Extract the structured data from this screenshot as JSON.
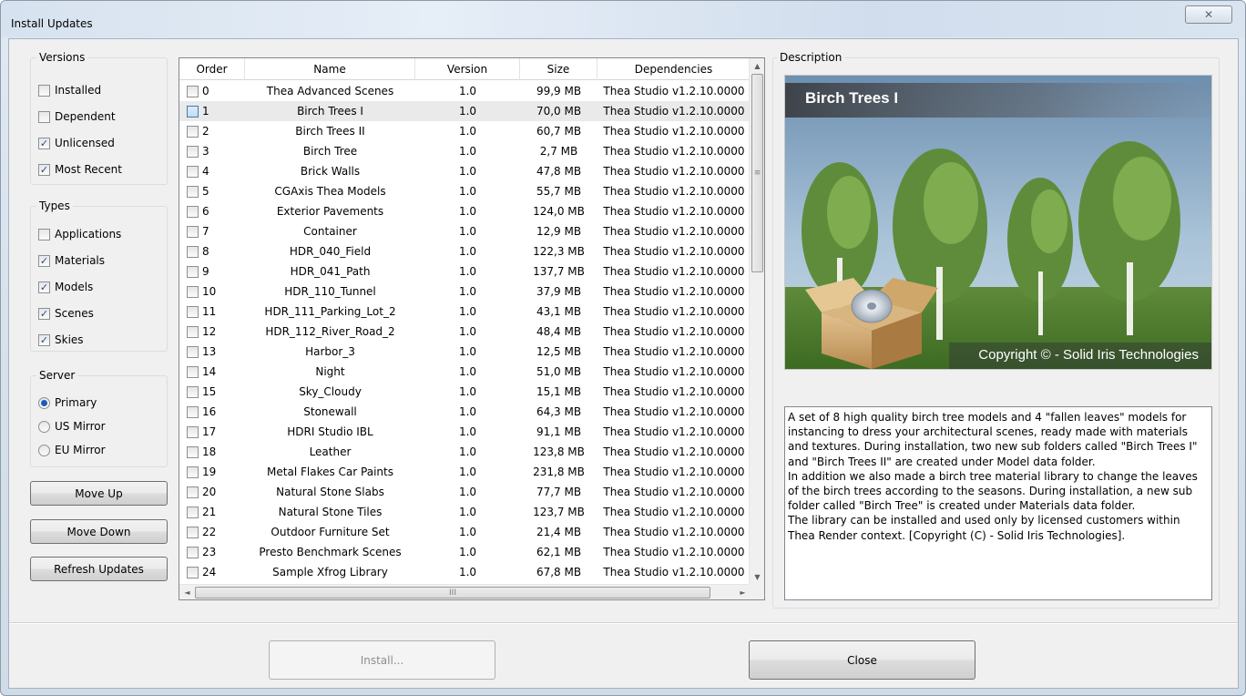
{
  "window": {
    "title": "Install Updates",
    "close_glyph": "✕"
  },
  "versions": {
    "title": "Versions",
    "items": [
      {
        "label": "Installed",
        "checked": false
      },
      {
        "label": "Dependent",
        "checked": false
      },
      {
        "label": "Unlicensed",
        "checked": true
      },
      {
        "label": "Most Recent",
        "checked": true
      }
    ]
  },
  "types": {
    "title": "Types",
    "items": [
      {
        "label": "Applications",
        "checked": false
      },
      {
        "label": "Materials",
        "checked": true
      },
      {
        "label": "Models",
        "checked": true
      },
      {
        "label": "Scenes",
        "checked": true
      },
      {
        "label": "Skies",
        "checked": true
      }
    ]
  },
  "server": {
    "title": "Server",
    "items": [
      {
        "label": "Primary",
        "selected": true
      },
      {
        "label": "US Mirror",
        "selected": false
      },
      {
        "label": "EU Mirror",
        "selected": false
      }
    ]
  },
  "buttons": {
    "move_up": "Move Up",
    "move_down": "Move Down",
    "refresh": "Refresh Updates",
    "install": "Install...",
    "close": "Close"
  },
  "list": {
    "columns": [
      "Order",
      "Name",
      "Version",
      "Size",
      "Dependencies"
    ],
    "selected_index": 1,
    "rows": [
      {
        "order": "0",
        "name": "Thea Advanced Scenes",
        "version": "1.0",
        "size": "99,9 MB",
        "deps": "Thea Studio v1.2.10.0000"
      },
      {
        "order": "1",
        "name": "Birch Trees I",
        "version": "1.0",
        "size": "70,0 MB",
        "deps": "Thea Studio v1.2.10.0000"
      },
      {
        "order": "2",
        "name": "Birch Trees II",
        "version": "1.0",
        "size": "60,7 MB",
        "deps": "Thea Studio v1.2.10.0000"
      },
      {
        "order": "3",
        "name": "Birch Tree",
        "version": "1.0",
        "size": "2,7 MB",
        "deps": "Thea Studio v1.2.10.0000"
      },
      {
        "order": "4",
        "name": "Brick Walls",
        "version": "1.0",
        "size": "47,8 MB",
        "deps": "Thea Studio v1.2.10.0000"
      },
      {
        "order": "5",
        "name": "CGAxis Thea Models",
        "version": "1.0",
        "size": "55,7 MB",
        "deps": "Thea Studio v1.2.10.0000"
      },
      {
        "order": "6",
        "name": "Exterior Pavements",
        "version": "1.0",
        "size": "124,0 MB",
        "deps": "Thea Studio v1.2.10.0000"
      },
      {
        "order": "7",
        "name": "Container",
        "version": "1.0",
        "size": "12,9 MB",
        "deps": "Thea Studio v1.2.10.0000"
      },
      {
        "order": "8",
        "name": "HDR_040_Field",
        "version": "1.0",
        "size": "122,3 MB",
        "deps": "Thea Studio v1.2.10.0000"
      },
      {
        "order": "9",
        "name": "HDR_041_Path",
        "version": "1.0",
        "size": "137,7 MB",
        "deps": "Thea Studio v1.2.10.0000"
      },
      {
        "order": "10",
        "name": "HDR_110_Tunnel",
        "version": "1.0",
        "size": "37,9 MB",
        "deps": "Thea Studio v1.2.10.0000"
      },
      {
        "order": "11",
        "name": "HDR_111_Parking_Lot_2",
        "version": "1.0",
        "size": "43,1 MB",
        "deps": "Thea Studio v1.2.10.0000"
      },
      {
        "order": "12",
        "name": "HDR_112_River_Road_2",
        "version": "1.0",
        "size": "48,4 MB",
        "deps": "Thea Studio v1.2.10.0000"
      },
      {
        "order": "13",
        "name": "Harbor_3",
        "version": "1.0",
        "size": "12,5 MB",
        "deps": "Thea Studio v1.2.10.0000"
      },
      {
        "order": "14",
        "name": "Night",
        "version": "1.0",
        "size": "51,0 MB",
        "deps": "Thea Studio v1.2.10.0000"
      },
      {
        "order": "15",
        "name": "Sky_Cloudy",
        "version": "1.0",
        "size": "15,1 MB",
        "deps": "Thea Studio v1.2.10.0000"
      },
      {
        "order": "16",
        "name": "Stonewall",
        "version": "1.0",
        "size": "64,3 MB",
        "deps": "Thea Studio v1.2.10.0000"
      },
      {
        "order": "17",
        "name": "HDRI Studio IBL",
        "version": "1.0",
        "size": "91,1 MB",
        "deps": "Thea Studio v1.2.10.0000"
      },
      {
        "order": "18",
        "name": "Leather",
        "version": "1.0",
        "size": "123,8 MB",
        "deps": "Thea Studio v1.2.10.0000"
      },
      {
        "order": "19",
        "name": "Metal Flakes Car Paints",
        "version": "1.0",
        "size": "231,8 MB",
        "deps": "Thea Studio v1.2.10.0000"
      },
      {
        "order": "20",
        "name": "Natural Stone Slabs",
        "version": "1.0",
        "size": "77,7 MB",
        "deps": "Thea Studio v1.2.10.0000"
      },
      {
        "order": "21",
        "name": "Natural Stone Tiles",
        "version": "1.0",
        "size": "123,7 MB",
        "deps": "Thea Studio v1.2.10.0000"
      },
      {
        "order": "22",
        "name": "Outdoor Furniture Set",
        "version": "1.0",
        "size": "21,4 MB",
        "deps": "Thea Studio v1.2.10.0000"
      },
      {
        "order": "23",
        "name": "Presto Benchmark Scenes",
        "version": "1.0",
        "size": "62,1 MB",
        "deps": "Thea Studio v1.2.10.0000"
      },
      {
        "order": "24",
        "name": "Sample Xfrog Library",
        "version": "1.0",
        "size": "67,8 MB",
        "deps": "Thea Studio v1.2.10.0000"
      }
    ]
  },
  "description": {
    "title": "Description",
    "image_title": "Birch Trees I",
    "image_copyright": "Copyright © - Solid Iris Technologies",
    "text": "A set of 8 high quality birch tree models and 4 \"fallen leaves\" models for\ninstancing to dress your architectural scenes, ready made with materials\nand textures. During installation, two new sub folders called \"Birch Trees I\"\nand \"Birch Trees II\" are created under Model data folder.\nIn addition we also made a birch tree material library to change the leaves\nof the birch trees according to the seasons. During installation, a new sub\nfolder called \"Birch Tree\" is created under Materials data folder.\nThe library can be installed and used only by licensed customers within\nThea Render context. [Copyright (C) - Solid Iris Technologies]."
  },
  "icons": {
    "check": "✓",
    "scroll_up": "▲",
    "scroll_down": "▼",
    "scroll_left": "◄",
    "scroll_right": "►",
    "grip": "≡",
    "grip_h": "III"
  }
}
